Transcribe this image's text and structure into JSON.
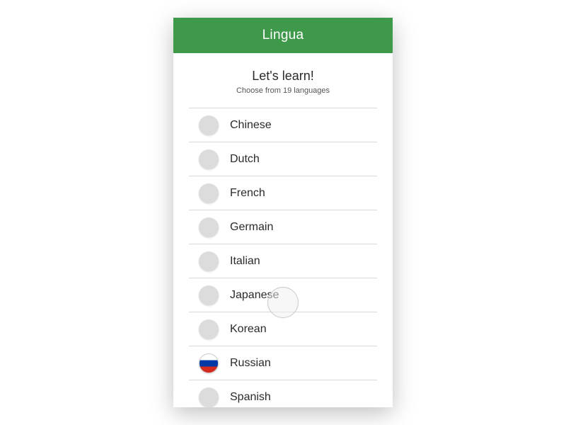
{
  "header": {
    "title": "Lingua"
  },
  "intro": {
    "title": "Let's learn!",
    "subtitle": "Choose from 19 languages"
  },
  "languages": [
    {
      "name": "Chinese",
      "flag": "placeholder"
    },
    {
      "name": "Dutch",
      "flag": "placeholder"
    },
    {
      "name": "French",
      "flag": "placeholder"
    },
    {
      "name": "Germain",
      "flag": "placeholder"
    },
    {
      "name": "Italian",
      "flag": "placeholder"
    },
    {
      "name": "Japanese",
      "flag": "placeholder"
    },
    {
      "name": "Korean",
      "flag": "placeholder"
    },
    {
      "name": "Russian",
      "flag": "russia"
    },
    {
      "name": "Spanish",
      "flag": "placeholder"
    }
  ],
  "colors": {
    "accent": "#3e9a4a"
  }
}
